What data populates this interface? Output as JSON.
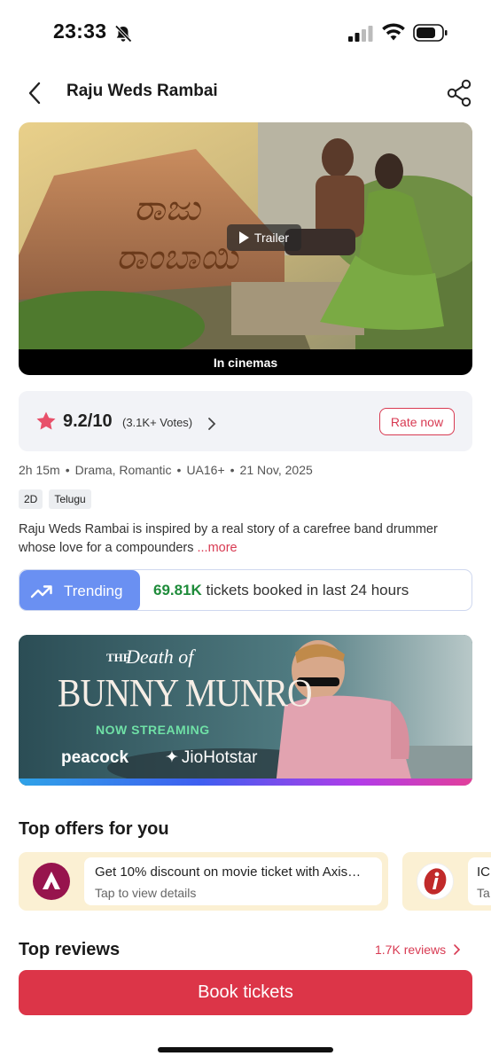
{
  "status_bar": {
    "time": "23:33",
    "icons": [
      "bell-off-icon",
      "signal-icon",
      "wifi-icon",
      "battery-icon"
    ]
  },
  "header": {
    "title": "Raju Weds Rambai",
    "back_icon": "chevron-left-icon",
    "share_icon": "share-icon"
  },
  "poster": {
    "trailer_label": "Trailer",
    "strip_label": "In cinemas"
  },
  "rating": {
    "score": "9.2/10",
    "votes": "(3.1K+ Votes)",
    "rate_label": "Rate now",
    "star_color": "#e8506a"
  },
  "meta": {
    "duration": "2h 15m",
    "genres": "Drama, Romantic",
    "certificate": "UA16+",
    "release_date": "21 Nov, 2025",
    "formats": [
      "2D",
      "Telugu"
    ]
  },
  "synopsis": {
    "text": "Raju Weds Rambai is inspired by a real story of a carefree band drummer whose love for a compounders ",
    "more_label": "...more"
  },
  "trending": {
    "badge": "Trending",
    "count": "69.81K",
    "text": " tickets booked in last 24 hours"
  },
  "ad": {
    "the": "THE",
    "death_of": "Death of",
    "title": "BUNNY MUNRO",
    "tagline": "NOW STREAMING",
    "brand1": "peacock",
    "brand2": "JioHotstar"
  },
  "offers": {
    "section_title": "Top offers for you",
    "items": [
      {
        "title": "Get 10% discount on movie ticket with Axis…",
        "subtitle": "Tap to view details",
        "logo": "axis-bank-logo"
      },
      {
        "title": "IC",
        "subtitle": "Ta",
        "logo": "icici-bank-logo"
      }
    ]
  },
  "reviews": {
    "section_title": "Top reviews",
    "count_label": "1.7K reviews"
  },
  "cta": {
    "book_label": "Book tickets"
  },
  "colors": {
    "accent": "#dc3548",
    "trending_badge": "#6a90f2",
    "trending_count": "#1f8c3b",
    "offer_bg": "#fbf0d3"
  }
}
